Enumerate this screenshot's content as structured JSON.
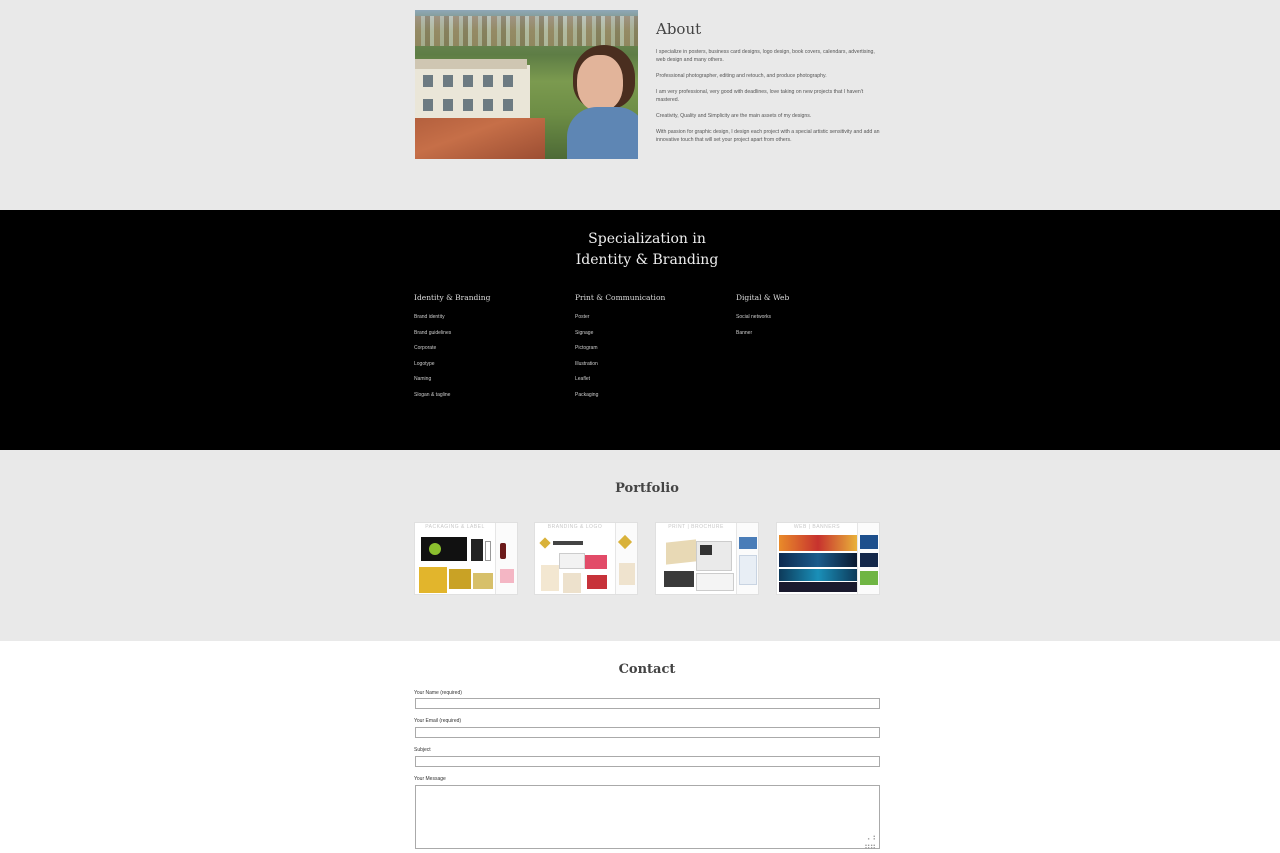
{
  "about": {
    "title": "About",
    "paragraphs": [
      "I specialize in posters, business card designs, logo design, book covers, calendars, advertising, web design and many others.",
      "Professional photographer, editing and retouch, and produce photography.",
      "I am very professional, very good with deadlines, love taking on new projects that I haven't mastered.",
      "Creativity, Quality and Simplicity are the main assets of my designs.",
      "With passion for graphic design, I design each project with a special artistic sensitivity and add an innovative touch that will set your project apart from others."
    ]
  },
  "specialization": {
    "title_line1": "Specialization in",
    "title_line2": "Identity & Branding",
    "columns": [
      {
        "title": "Identity & Branding",
        "items": [
          "Brand identity",
          "Brand guidelines",
          "Corporate",
          "Logotype",
          "Naming",
          "Slogan & tagline"
        ]
      },
      {
        "title": "Print & Communication",
        "items": [
          "Poster",
          "Signage",
          "Pictogram",
          "Illustration",
          "Leaflet",
          "Packaging"
        ]
      },
      {
        "title": "Digital & Web",
        "items": [
          "Social networks",
          "Banner"
        ]
      }
    ]
  },
  "portfolio": {
    "title": "Portfolio",
    "items": [
      {
        "label": "PACKAGING & LABEL"
      },
      {
        "label": "BRANDING & LOGO"
      },
      {
        "label": "PRINT | BROCHURE"
      },
      {
        "label": "WEB | BANNERS"
      }
    ]
  },
  "contact": {
    "title": "Contact",
    "name_label": "Your Name (required)",
    "email_label": "Your Email (required)",
    "subject_label": "Subject",
    "message_label": "Your Message"
  },
  "colors": {
    "section_gray": "#e9e9e9",
    "specialization_bg": "#000000",
    "contact_bg": "#ffffff"
  }
}
